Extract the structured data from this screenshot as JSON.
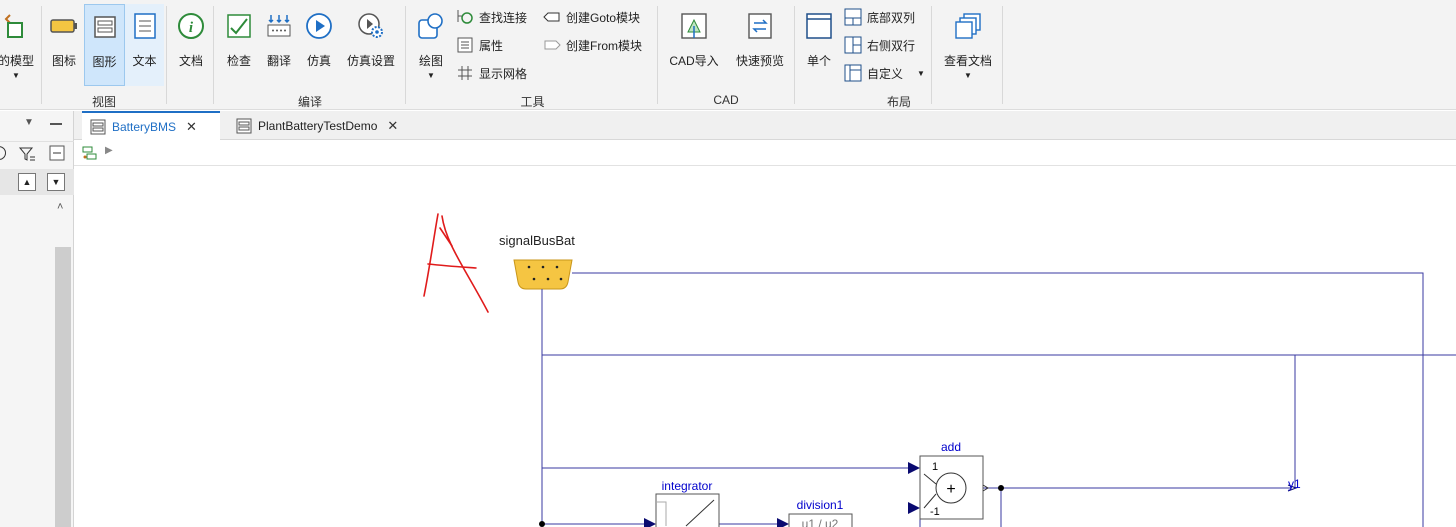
{
  "ribbon": {
    "view_group": {
      "label": "视图",
      "cut_button": "的模型",
      "icon_button": "图标",
      "graphic_button": "图形",
      "text_button": "文本"
    },
    "doc_button": "文档",
    "compile_group": {
      "label": "编译",
      "check": "检查",
      "translate": "翻译",
      "simulate": "仿真",
      "sim_settings": "仿真设置"
    },
    "tools_group": {
      "label": "工具",
      "draw": "绘图",
      "find_connection": "查找连接",
      "properties": "属性",
      "show_grid": "显示网格",
      "create_goto": "创建Goto模块",
      "create_from": "创建From模块"
    },
    "cad_group": {
      "label": "CAD",
      "cad_import": "CAD导入",
      "quick_preview": "快速预览"
    },
    "layout_group": {
      "label": "布局",
      "single": "单个",
      "bottom_two_cols": "底部双列",
      "right_two_rows": "右侧双行",
      "custom": "自定义"
    },
    "view_docs": "查看文档"
  },
  "tabs": [
    {
      "label": "BatteryBMS",
      "active": true
    },
    {
      "label": "PlantBatteryTestDemo",
      "active": false
    }
  ],
  "diagram": {
    "bus_label": "signalBusBat",
    "add_block": {
      "name": "add",
      "in1": "1",
      "in2": "-1",
      "symbol": "+"
    },
    "integrator_block": {
      "name": "integrator"
    },
    "division_block": {
      "name": "division1",
      "text": "u1 / u2"
    },
    "output_label": "y1",
    "wire_color": "#1a1a80",
    "bus_color": "#f5c542",
    "annotation_color": "#e01b1b"
  }
}
